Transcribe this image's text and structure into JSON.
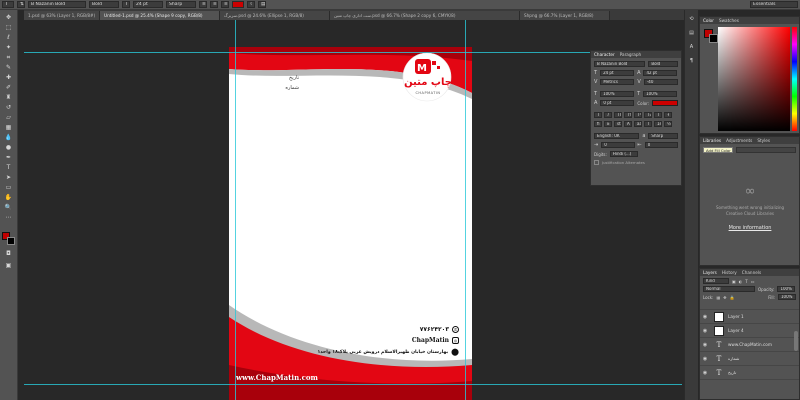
{
  "options_bar": {
    "font_family": "B Nazanin Bold",
    "font_style": "Bold",
    "font_size": "24 pt",
    "anti_alias": "Sharp",
    "text_color": "#cc0000",
    "workspace": "Essentials"
  },
  "doc_tabs": [
    {
      "label": "1.psd @ 63% (Layer 1, RGB/8#)",
      "active": false
    },
    {
      "label": "Untitled-1.psd @ 25.4% (Shape 9 copy, RGB/8)",
      "active": true
    },
    {
      "label": "سربرگ.psd @ 24.6% (Ellipse 1, RGB/8)",
      "active": false
    },
    {
      "label": "ست اداری چاپ متین.psd @ 66.7% (Shape 2 copy 6, CMYK/8)",
      "active": false
    },
    {
      "label": "Shpng @ 66.7% (Layer 1, RGB/8)",
      "active": false
    }
  ],
  "letterhead": {
    "date_label": "تاریخ",
    "number_label": "شماره",
    "logo_name": "چاپ متین",
    "logo_tagline": "CHAPMATIN",
    "phone": "۷۷۶۲۴۲۰۳",
    "instagram": "ChapMatin",
    "address": "بهارستان خیابان ظهیرالاسلام درویش غربی پلاک۱۸ واحد۱",
    "website": "www.ChapMatin.com"
  },
  "character_panel": {
    "tabs": [
      "Character",
      "Paragraph"
    ],
    "font_family": "B Nazanin Bold",
    "font_style": "Bold",
    "font_size": "24 pt",
    "leading": "42 pt",
    "kerning": "Metrics",
    "tracking": "-40",
    "vertical_scale": "100%",
    "horizontal_scale": "100%",
    "baseline_shift": "0 pt",
    "color_label": "Color:",
    "language": "English: UK",
    "anti_alias": "Sharp",
    "digits_label": "Digits:",
    "digits_value": "Hindi (...)",
    "justification_label": "Justification Alternates",
    "style_buttons": [
      "T",
      "T",
      "TT",
      "Tт",
      "T¹",
      "T₁",
      "T",
      "Ŧ"
    ],
    "opentype_buttons": [
      "fi",
      "ꝺ",
      "st",
      "A",
      "aa",
      "T",
      "1st",
      "½"
    ]
  },
  "color_panel": {
    "tabs": [
      "Color",
      "Swatches"
    ],
    "foreground": "#c00000",
    "hue": "#ff0000"
  },
  "libraries_panel": {
    "tabs": [
      "Libraries",
      "Adjustments",
      "Styles"
    ],
    "tooltip": "Add Fill Color",
    "message": "Something went wrong initializing Creative Cloud Libraries",
    "link": "More information"
  },
  "layers_panel": {
    "tabs": [
      "Layers",
      "History",
      "Channels"
    ],
    "filter_kind": "Kind",
    "blend_mode": "Normal",
    "opacity_label": "Opacity:",
    "opacity": "100%",
    "lock_label": "Lock:",
    "fill_label": "Fill:",
    "fill": "100%",
    "layers": [
      {
        "name": "Layer 1",
        "type": "image"
      },
      {
        "name": "Layer 4",
        "type": "image"
      },
      {
        "name": "www.ChapMatin.com",
        "type": "text"
      },
      {
        "name": "شماره",
        "type": "text"
      },
      {
        "name": "تاریخ",
        "type": "text"
      }
    ]
  },
  "colors": {
    "accent_red": "#e30613",
    "dark_red": "#a8000b",
    "swoosh_gray": "#b8b8b8",
    "guide": "#28c8d8"
  }
}
